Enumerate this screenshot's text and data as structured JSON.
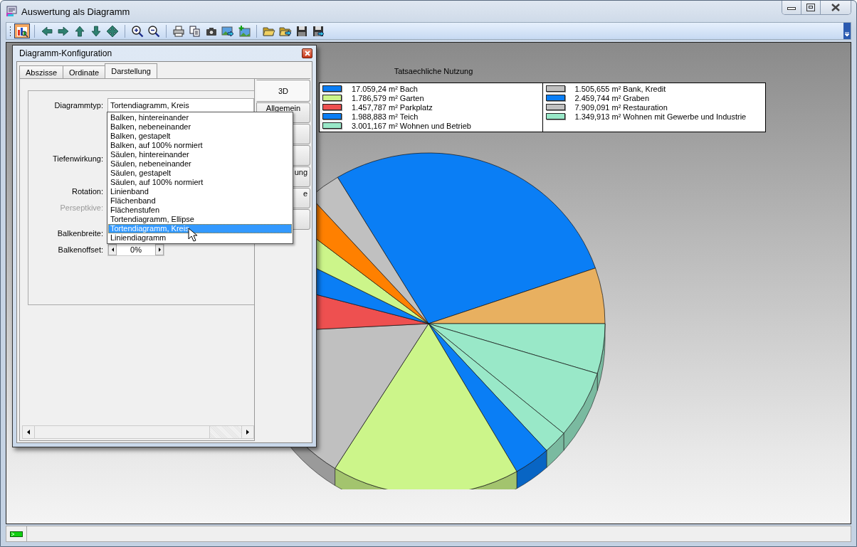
{
  "window": {
    "title": "Auswertung als Diagramm"
  },
  "toolbar_groups": [
    {
      "buttons": [
        {
          "kind": "chart",
          "pressed": true
        }
      ]
    },
    {
      "buttons": [
        {
          "kind": "left",
          "pressed": false
        },
        {
          "kind": "right",
          "pressed": false
        },
        {
          "kind": "up",
          "pressed": false
        },
        {
          "kind": "down",
          "pressed": false
        },
        {
          "kind": "move",
          "pressed": false
        }
      ]
    },
    {
      "buttons": [
        {
          "kind": "zoom-in",
          "pressed": false
        },
        {
          "kind": "zoom-out",
          "pressed": false
        }
      ]
    },
    {
      "buttons": [
        {
          "kind": "print",
          "pressed": false
        },
        {
          "kind": "copy",
          "pressed": false
        },
        {
          "kind": "camera",
          "pressed": false
        },
        {
          "kind": "image-export",
          "pressed": false
        },
        {
          "kind": "image-add",
          "pressed": false
        }
      ]
    },
    {
      "buttons": [
        {
          "kind": "folder-open",
          "pressed": false
        },
        {
          "kind": "folder-export",
          "pressed": false
        },
        {
          "kind": "save",
          "pressed": false
        },
        {
          "kind": "save-as",
          "pressed": false
        }
      ]
    }
  ],
  "chart": {
    "title": "Tatsaechliche Nutzung",
    "legend_columns": [
      {
        "entries": [
          {
            "color": "#0a7ef5",
            "label": "17.059,24 m² Bach"
          },
          {
            "color": "#ccf58a",
            "label": "1.786,579 m² Garten"
          },
          {
            "color": "#ee5050",
            "label": "1.457,787 m² Parkplatz"
          },
          {
            "color": "#0a7ef5",
            "label": "1.988,883 m² Teich"
          },
          {
            "color": "#99e8c8",
            "label": "3.001,167 m² Wohnen und Betrieb"
          }
        ]
      },
      {
        "entries": [
          {
            "color": "#c0c0c0",
            "label": "1.505,655 m² Bank, Kredit"
          },
          {
            "color": "#0a7ef5",
            "label": "2.459,744 m² Graben"
          },
          {
            "color": "#c0c0c0",
            "label": "7.909,091 m² Restauration"
          },
          {
            "color": "#99e8c8",
            "label": "1.349,913 m² Wohnen mit Gewerbe und Industrie"
          }
        ]
      }
    ]
  },
  "dialog": {
    "title": "Diagramm-Konfiguration",
    "tabs": [
      {
        "label": "Abszisse",
        "selected": false
      },
      {
        "label": "Ordinate",
        "selected": false
      },
      {
        "label": "Darstellung",
        "selected": true
      }
    ],
    "side_tabs": [
      {
        "kind": "full",
        "label": "3D",
        "selected": true
      },
      {
        "kind": "full",
        "label": "Allgemein",
        "selected": false
      },
      {
        "kind": "covered",
        "selected": false
      },
      {
        "kind": "covered",
        "selected": false
      },
      {
        "kind": "partial",
        "label": "ung",
        "selected": false
      },
      {
        "kind": "partial",
        "label": "e",
        "selected": false
      },
      {
        "kind": "covered",
        "selected": false
      }
    ],
    "fields": [
      {
        "kind": "combo",
        "label": "Diagrammtyp:",
        "disabled": false,
        "value": "Tortendiagramm, Kreis"
      },
      {
        "kind": "covered",
        "label": "Tiefenwirkung:",
        "disabled": false
      },
      {
        "kind": "covered",
        "label": "Rotation:",
        "disabled": false
      },
      {
        "kind": "covered",
        "label": "Perseptkive:",
        "disabled": true
      },
      {
        "kind": "covered",
        "label": "Balkenbreite:",
        "disabled": false
      },
      {
        "kind": "spinner",
        "label": "Balkenoffset:",
        "disabled": false,
        "value": "0%"
      }
    ],
    "dropdown": {
      "options": [
        {
          "label": "Balken, hintereinander",
          "selected": false
        },
        {
          "label": "Balken, nebeneinander",
          "selected": false
        },
        {
          "label": "Balken, gestapelt",
          "selected": false
        },
        {
          "label": "Balken, auf 100% normiert",
          "selected": false
        },
        {
          "label": "Säulen, hintereinander",
          "selected": false
        },
        {
          "label": "Säulen, nebeneinander",
          "selected": false
        },
        {
          "label": "Säulen, gestapelt",
          "selected": false
        },
        {
          "label": "Säulen, auf 100% normiert",
          "selected": false
        },
        {
          "label": "Linienband",
          "selected": false
        },
        {
          "label": "Flächenband",
          "selected": false
        },
        {
          "label": "Flächenstufen",
          "selected": false
        },
        {
          "label": "Tortendiagramm, Ellipse",
          "selected": false
        },
        {
          "label": "Tortendiagramm, Kreis",
          "selected": true
        },
        {
          "label": "Liniendiagramm",
          "selected": false
        }
      ]
    }
  }
}
